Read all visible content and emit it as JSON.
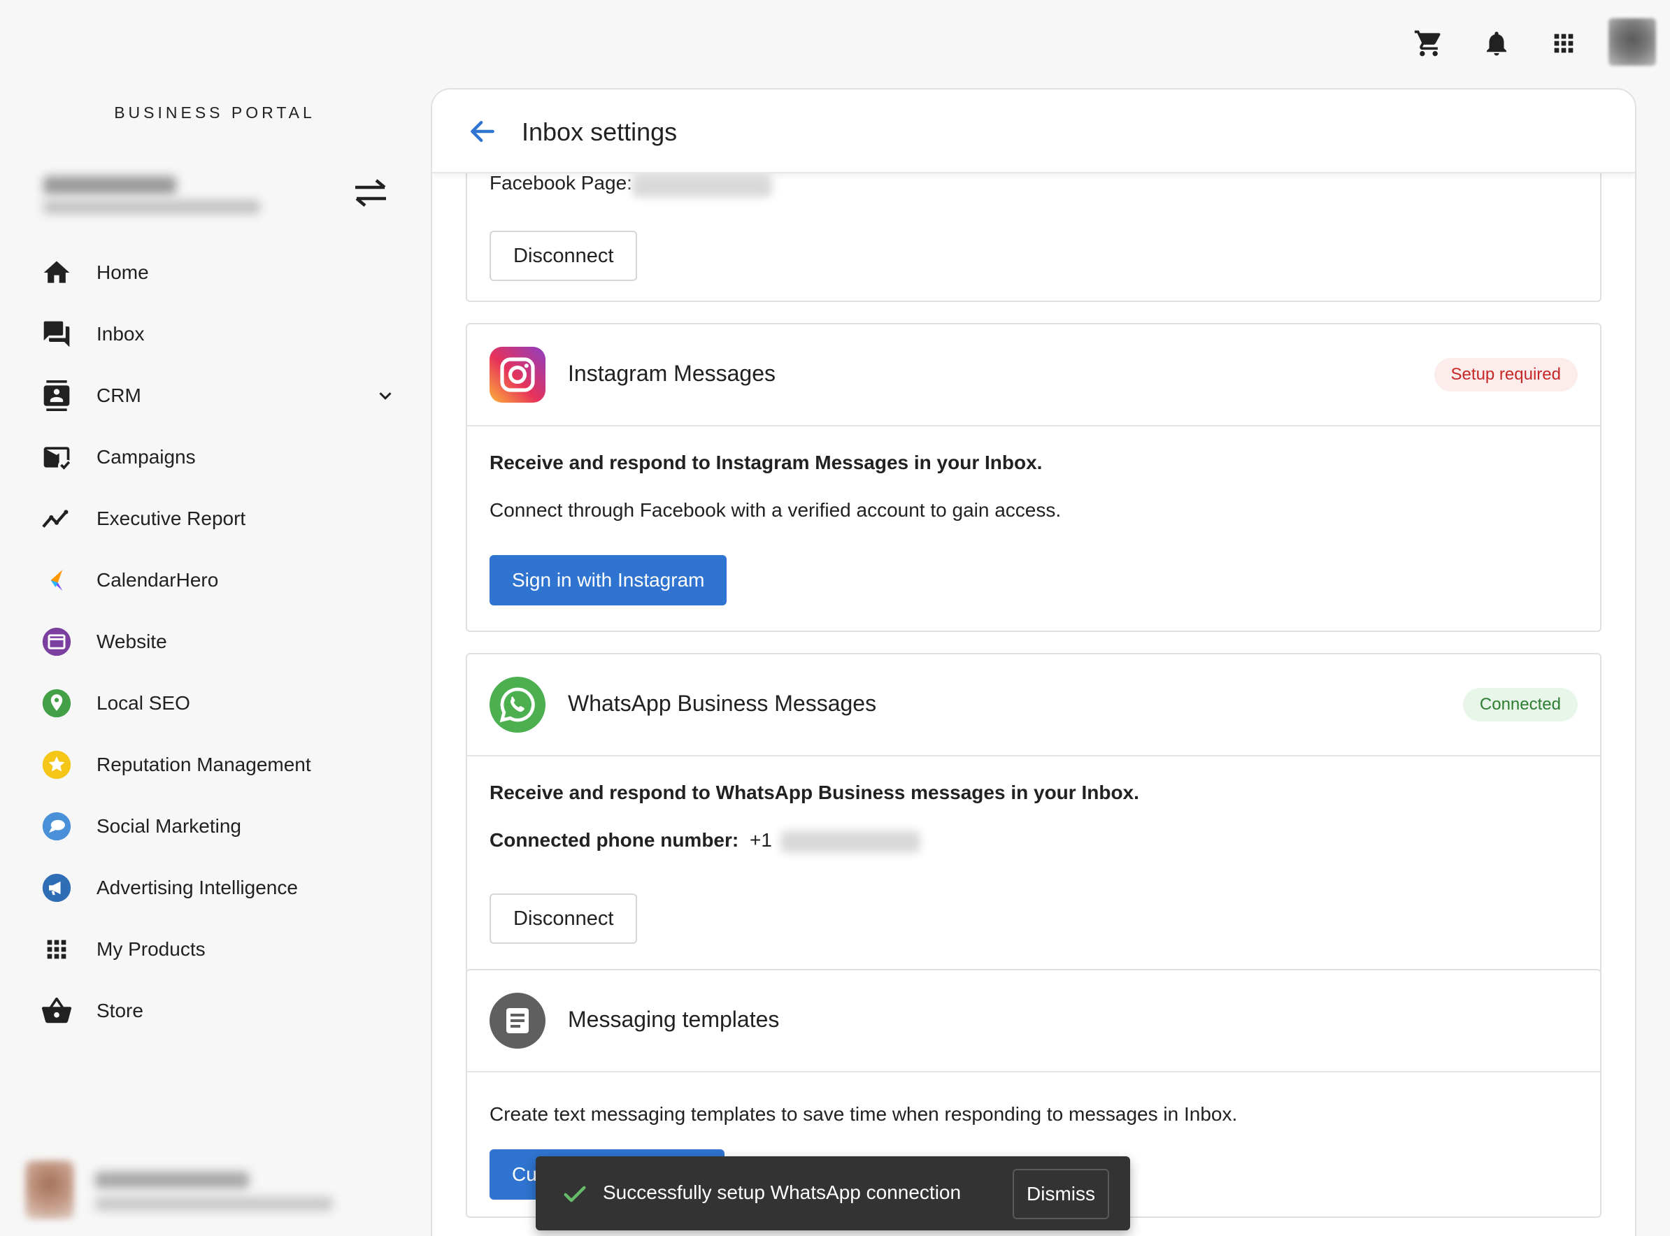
{
  "brand": "BUSINESS PORTAL",
  "sidebar": {
    "items": [
      {
        "label": "Home",
        "icon": "home-icon"
      },
      {
        "label": "Inbox",
        "icon": "chat-icon"
      },
      {
        "label": "CRM",
        "icon": "contacts-icon"
      },
      {
        "label": "Campaigns",
        "icon": "mail-check-icon"
      },
      {
        "label": "Executive Report",
        "icon": "trend-line-icon"
      },
      {
        "label": "CalendarHero",
        "icon": "calendarhero-icon"
      },
      {
        "label": "Website",
        "icon": "website-icon"
      },
      {
        "label": "Local SEO",
        "icon": "map-pin-icon"
      },
      {
        "label": "Reputation Management",
        "icon": "star-icon"
      },
      {
        "label": "Social Marketing",
        "icon": "chat-bubble-icon"
      },
      {
        "label": "Advertising Intelligence",
        "icon": "megaphone-icon"
      },
      {
        "label": "My Products",
        "icon": "grid-icon"
      },
      {
        "label": "Store",
        "icon": "basket-icon"
      }
    ]
  },
  "header": {
    "title": "Inbox settings"
  },
  "facebook": {
    "page_label": "Facebook Page:",
    "disconnect": "Disconnect"
  },
  "instagram": {
    "title": "Instagram Messages",
    "badge": "Setup required",
    "headline": "Receive and respond to Instagram Messages in your Inbox.",
    "desc": "Connect through Facebook with a verified account to gain access.",
    "button": "Sign in with Instagram"
  },
  "whatsapp": {
    "title": "WhatsApp Business Messages",
    "badge": "Connected",
    "headline": "Receive and respond to WhatsApp Business messages in your Inbox.",
    "phone_label": "Connected phone number:",
    "phone_prefix": "+1",
    "disconnect": "Disconnect"
  },
  "templates": {
    "title": "Messaging templates",
    "desc": "Create text messaging templates to save time when responding to messages in Inbox.",
    "button_visible": "Cu"
  },
  "toast": {
    "message": "Successfully setup WhatsApp connection",
    "dismiss": "Dismiss"
  },
  "colors": {
    "primary": "#2f74d0",
    "badge_warn_bg": "#fdecec",
    "badge_warn_text": "#c62828",
    "badge_ok_bg": "#e8f5e9",
    "badge_ok_text": "#2e7d32",
    "toast_bg": "#333333"
  }
}
